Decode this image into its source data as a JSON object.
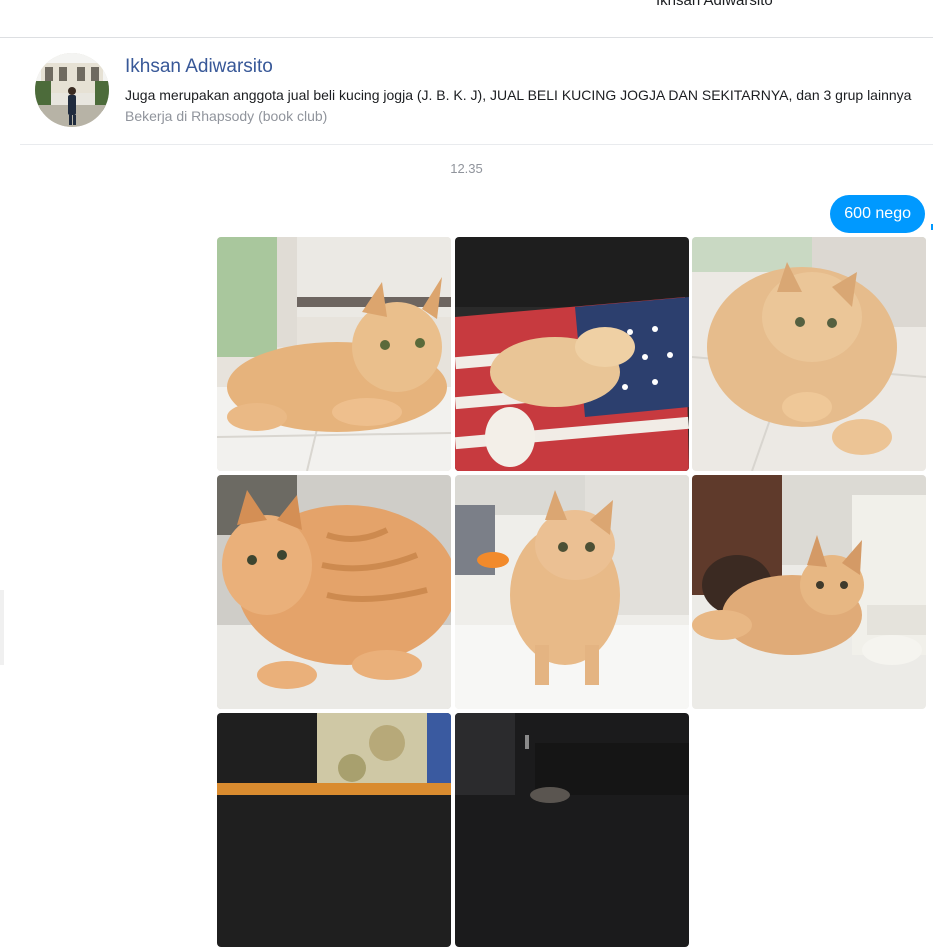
{
  "header": {
    "title": "Ikhsan Adiwarsito"
  },
  "profile": {
    "name": "Ikhsan Adiwarsito",
    "groups": "Juga merupakan anggota jual beli kucing jogja (J. B. K. J), JUAL BELI KUCING JOGJA DAN SEKITARNYA, dan 3 grup lainnya",
    "work": "Bekerja di Rhapsody (book club)"
  },
  "conversation": {
    "timestamp": "12.35",
    "message": "600 nego",
    "photos": [
      {
        "subject": "orange-cat-lying-on-floor"
      },
      {
        "subject": "cat-sleeping-on-flag-cushion"
      },
      {
        "subject": "orange-cat-lying-front-view"
      },
      {
        "subject": "orange-tabby-cat-close-up"
      },
      {
        "subject": "orange-cat-standing"
      },
      {
        "subject": "orange-cat-by-furniture"
      },
      {
        "subject": "curtain-and-cushion"
      },
      {
        "subject": "dark-photo-partial"
      }
    ]
  },
  "colors": {
    "link": "#385898",
    "bubble": "#0099ff",
    "muted": "#90949c",
    "text": "#1c1e21"
  }
}
